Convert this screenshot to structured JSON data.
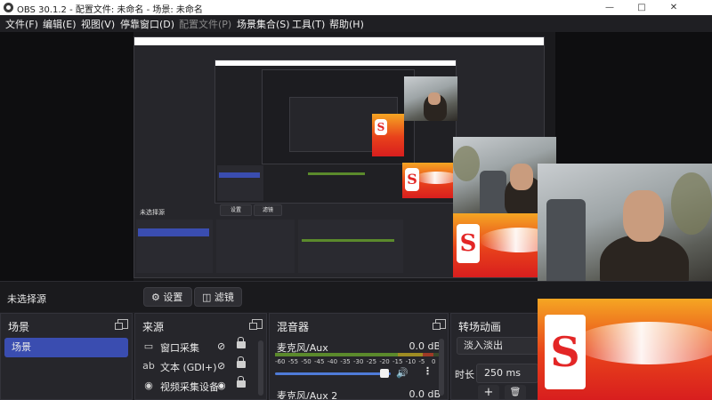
{
  "window": {
    "title": "OBS 30.1.2 - 配置文件: 未命名 - 场景: 未命名",
    "controls": {
      "minimize": "—",
      "maximize": "□",
      "close": "✕"
    }
  },
  "menu": [
    "文件(F)",
    "编辑(E)",
    "视图(V)",
    "停靠窗口(D)",
    "配置文件(P)",
    "场景集合(S)",
    "工具(T)",
    "帮助(H)"
  ],
  "status": {
    "no_source": "未选择源",
    "settings_button": "设置",
    "filters_button": "滤镜"
  },
  "scenes": {
    "title": "场景",
    "items": [
      "场景"
    ]
  },
  "sources": {
    "title": "来源",
    "items": [
      {
        "icon": "window-capture-icon",
        "label": "窗口采集",
        "visible": false
      },
      {
        "icon": "text-icon",
        "label": "文本 (GDI+)",
        "visible": false
      },
      {
        "icon": "camera-icon",
        "label": "视频采集设备",
        "visible": true
      }
    ]
  },
  "mixer": {
    "title": "混音器",
    "channels": [
      {
        "name": "麦克风/Aux",
        "db": "0.0 dB",
        "level": 0.97
      },
      {
        "name": "麦克风/Aux 2",
        "db": "0.0 dB",
        "level": 0.0
      }
    ],
    "ticks": [
      "-60",
      "-55",
      "-50",
      "-45",
      "-40",
      "-35",
      "-30",
      "-25",
      "-20",
      "-15",
      "-10",
      "-5",
      "0"
    ]
  },
  "transitions": {
    "title": "转场动画",
    "selected": "淡入淡出",
    "duration_label": "时长",
    "duration_value": "250 ms",
    "add_label": "+",
    "delete_label": "🗑"
  },
  "preview": {
    "badge_letter": "S",
    "nested_status": "未选择源",
    "nested_settings": "设置",
    "nested_filters": "滤镜"
  },
  "colors": {
    "accent": "#3a4db0",
    "meter_green": "#5b8a2c",
    "slider": "#4f7bd8"
  }
}
